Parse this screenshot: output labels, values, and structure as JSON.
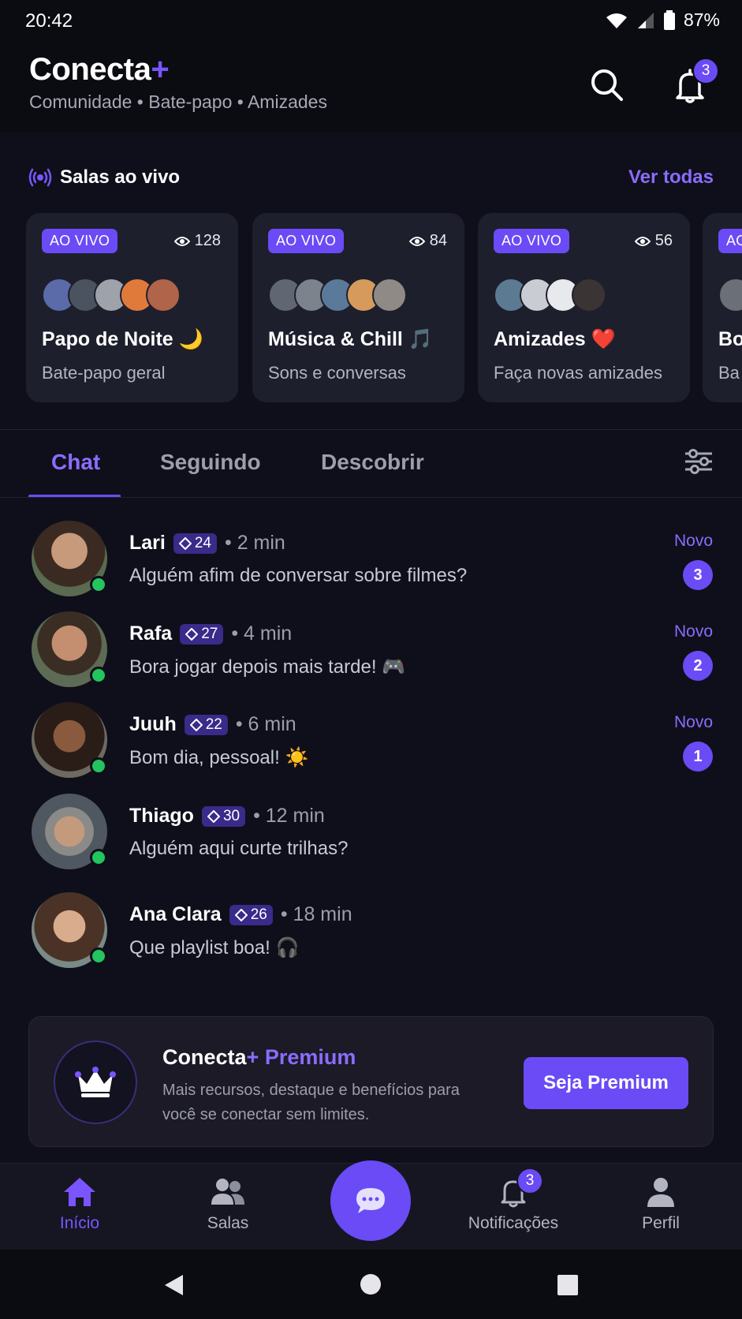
{
  "status_bar": {
    "time": "20:42",
    "battery": "87%"
  },
  "header": {
    "brand": "Conecta",
    "brand_plus": "+",
    "tagline": "Comunidade • Bate-papo • Amizades",
    "notification_count": "3"
  },
  "live": {
    "title": "Salas ao vivo",
    "see_all": "Ver todas",
    "rooms": [
      {
        "badge": "AO VIVO",
        "viewers": "128",
        "name": "Papo de Noite 🌙",
        "subtitle": "Bate-papo geral"
      },
      {
        "badge": "AO VIVO",
        "viewers": "84",
        "name": "Música & Chill 🎵",
        "subtitle": "Sons e conversas"
      },
      {
        "badge": "AO VIVO",
        "viewers": "56",
        "name": "Amizades ❤️",
        "subtitle": "Faça novas amizades"
      },
      {
        "badge": "AO VIVO",
        "viewers": "",
        "name": "Bo",
        "subtitle": "Ba"
      }
    ]
  },
  "tabs": [
    "Chat",
    "Seguindo",
    "Descobrir"
  ],
  "chats": [
    {
      "name": "Lari",
      "level": "24",
      "time": "• 2 min",
      "message": "Alguém afim de conversar sobre filmes?",
      "new_label": "Novo",
      "count": "3"
    },
    {
      "name": "Rafa",
      "level": "27",
      "time": "• 4 min",
      "message": "Bora jogar depois mais tarde! 🎮",
      "new_label": "Novo",
      "count": "2"
    },
    {
      "name": "Juuh",
      "level": "22",
      "time": "• 6 min",
      "message": "Bom dia, pessoal! ☀️",
      "new_label": "Novo",
      "count": "1"
    },
    {
      "name": "Thiago",
      "level": "30",
      "time": "• 12 min",
      "message": "Alguém aqui curte trilhas?",
      "new_label": "",
      "count": ""
    },
    {
      "name": "Ana Clara",
      "level": "26",
      "time": "• 18 min",
      "message": "Que playlist boa! 🎧",
      "new_label": "",
      "count": ""
    }
  ],
  "premium": {
    "title_brand": "Conecta",
    "title_plus": "+",
    "title_word": " Premium",
    "description": "Mais recursos, destaque e benefícios para você se conectar sem limites.",
    "button": "Seja Premium"
  },
  "bottom_nav": {
    "home": "Início",
    "rooms": "Salas",
    "notifications": "Notificações",
    "notifications_count": "3",
    "profile": "Perfil"
  },
  "colors": {
    "accent": "#6a4bf5",
    "accent_text": "#8b6cff",
    "online": "#22c55e",
    "background": "#0e0f1a"
  }
}
